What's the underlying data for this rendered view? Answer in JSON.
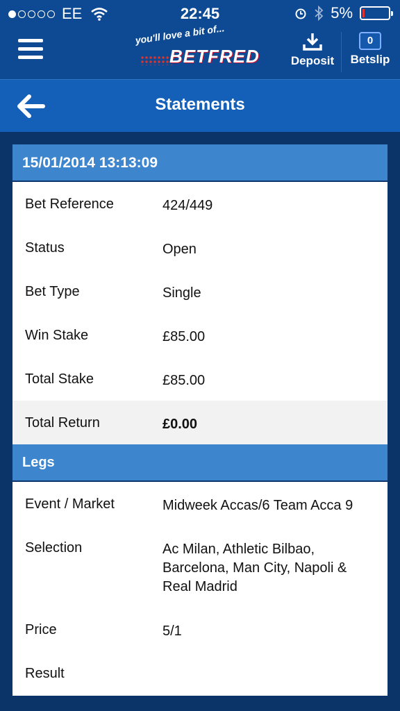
{
  "status_bar": {
    "carrier": "EE",
    "time": "22:45",
    "battery": "5%"
  },
  "app_bar": {
    "logo_tagline": "you'll love a bit of...",
    "logo_name": "BETFRED",
    "deposit_label": "Deposit",
    "betslip_label": "Betslip",
    "betslip_count": "0"
  },
  "title_bar": {
    "title": "Statements"
  },
  "statement": {
    "date_time": "15/01/2014 13:13:09",
    "rows": [
      {
        "label": "Bet Reference",
        "value": "424/449"
      },
      {
        "label": "Status",
        "value": "Open"
      },
      {
        "label": "Bet Type",
        "value": "Single"
      },
      {
        "label": "Win Stake",
        "value": "£85.00"
      },
      {
        "label": "Total Stake",
        "value": "£85.00"
      },
      {
        "label": "Total Return",
        "value": "£0.00"
      }
    ],
    "legs_heading": "Legs",
    "legs": [
      {
        "label": "Event / Market",
        "value": "Midweek Accas/6 Team Acca 9"
      },
      {
        "label": "Selection",
        "value": "Ac Milan, Athletic Bilbao, Barcelona, Man City, Napoli & Real Madrid"
      },
      {
        "label": "Price",
        "value": "5/1"
      },
      {
        "label": "Result",
        "value": ""
      }
    ]
  },
  "colors": {
    "header_blue": "#0d4a93",
    "title_blue": "#1460b8",
    "section_blue": "#3d85cd",
    "background_navy": "#0b3468"
  }
}
